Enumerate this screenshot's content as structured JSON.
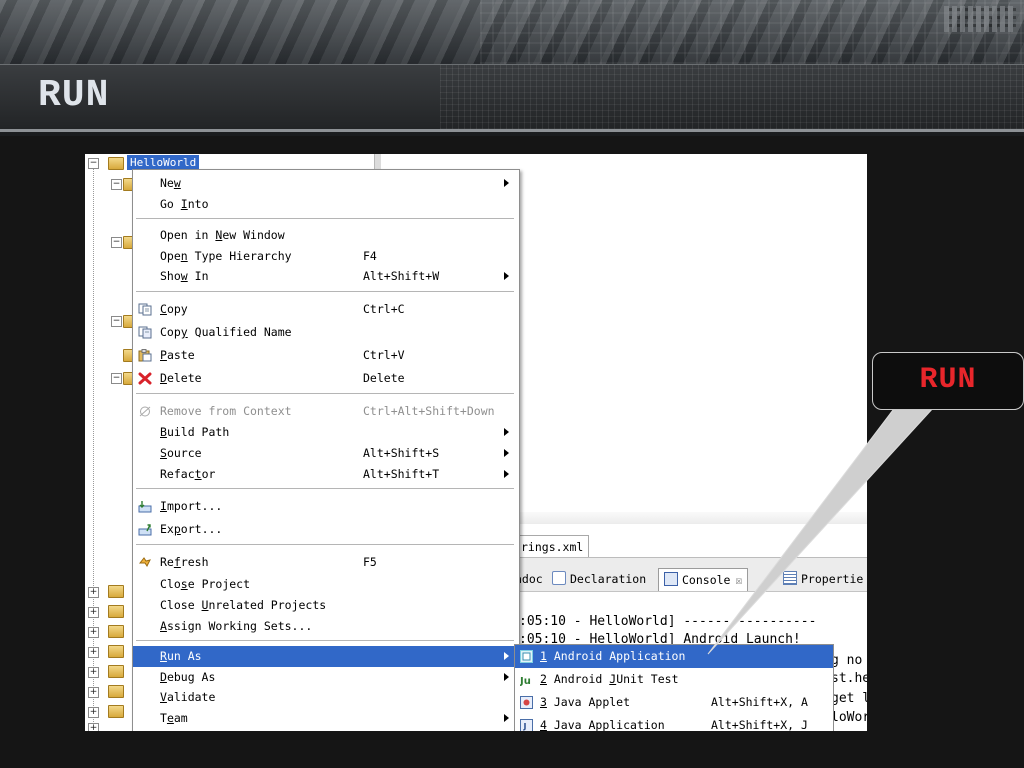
{
  "slide": {
    "title": "RUN",
    "callout_label": "RUN",
    "colors": {
      "background": "#151515",
      "callout_text": "#e8262b",
      "title_text": "#dfe4ea",
      "selection": "#3168c8"
    }
  },
  "explorer": {
    "project_label": "HelloWorld"
  },
  "editor": {
    "file_tab": "rings.xml"
  },
  "views": {
    "tabs": [
      {
        "label": "adoc",
        "icon": ""
      },
      {
        "label": "Declaration",
        "icon": "declaration-icon"
      },
      {
        "label": "Console",
        "icon": "console-icon",
        "close": "☒"
      },
      {
        "label": "Propertie",
        "icon": "properties-icon"
      }
    ]
  },
  "console": {
    "lines": [
      ":05:10 - HelloWorld] -----------------",
      ":05:10 - HelloWorld] Android Launch!"
    ],
    "right_fragments": [
      "g no",
      "st.he",
      "get l",
      "loWor"
    ]
  },
  "context_menu": {
    "items": [
      {
        "label": "New",
        "mnemonic_index": 2,
        "shortcut": "",
        "submenu": true
      },
      {
        "label": "Go Into",
        "mnemonic_index": 3,
        "shortcut": ""
      },
      {
        "label": "Open in New Window",
        "mnemonic_index": 8,
        "shortcut": ""
      },
      {
        "label": "Open Type Hierarchy",
        "mnemonic_index": 3,
        "shortcut": "F4"
      },
      {
        "label": "Show In",
        "mnemonic_index": 3,
        "shortcut": "Alt+Shift+W",
        "submenu": true
      },
      {
        "label": "Copy",
        "mnemonic_index": 0,
        "shortcut": "Ctrl+C",
        "icon": "copy-icon"
      },
      {
        "label": "Copy Qualified Name",
        "mnemonic_index": 3,
        "shortcut": "",
        "icon": "copy-qualified-name-icon"
      },
      {
        "label": "Paste",
        "mnemonic_index": 0,
        "shortcut": "Ctrl+V",
        "icon": "paste-icon"
      },
      {
        "label": "Delete",
        "mnemonic_index": 0,
        "shortcut": "Delete",
        "icon": "delete-icon"
      },
      {
        "label": "Remove from Context",
        "mnemonic_index": -1,
        "shortcut": "Ctrl+Alt+Shift+Down",
        "disabled": true,
        "icon": "remove-from-context-icon"
      },
      {
        "label": "Build Path",
        "mnemonic_index": 0,
        "shortcut": "",
        "submenu": true
      },
      {
        "label": "Source",
        "mnemonic_index": 0,
        "shortcut": "Alt+Shift+S",
        "submenu": true
      },
      {
        "label": "Refactor",
        "mnemonic_index": 5,
        "shortcut": "Alt+Shift+T",
        "submenu": true
      },
      {
        "label": "Import...",
        "mnemonic_index": 0,
        "shortcut": "",
        "icon": "import-icon"
      },
      {
        "label": "Export...",
        "mnemonic_index": 2,
        "shortcut": "",
        "icon": "export-icon"
      },
      {
        "label": "Refresh",
        "mnemonic_index": 2,
        "shortcut": "F5",
        "icon": "refresh-icon"
      },
      {
        "label": "Close Project",
        "mnemonic_index": 3,
        "shortcut": ""
      },
      {
        "label": "Close Unrelated Projects",
        "mnemonic_index": 6,
        "shortcut": ""
      },
      {
        "label": "Assign Working Sets...",
        "mnemonic_index": 0,
        "shortcut": ""
      },
      {
        "label": "Run As",
        "mnemonic_index": 0,
        "shortcut": "",
        "submenu": true,
        "selected": true
      },
      {
        "label": "Debug As",
        "mnemonic_index": 0,
        "shortcut": "",
        "submenu": true
      },
      {
        "label": "Validate",
        "mnemonic_index": 0,
        "shortcut": ""
      },
      {
        "label": "Team",
        "mnemonic_index": 1,
        "shortcut": "",
        "submenu": true
      }
    ]
  },
  "run_as_submenu": {
    "items": [
      {
        "num": "1",
        "label": "Android Application",
        "shortcut": "",
        "icon": "android-application-icon",
        "selected": true
      },
      {
        "num": "2",
        "label": "Android JUnit Test",
        "mnemonic_index": 8,
        "shortcut": "",
        "icon": "junit-icon"
      },
      {
        "num": "3",
        "label": "Java Applet",
        "shortcut": "Alt+Shift+X, A",
        "icon": "java-applet-icon"
      },
      {
        "num": "4",
        "label": "Java Application",
        "shortcut": "Alt+Shift+X, J",
        "icon": "java-application-icon"
      }
    ]
  }
}
